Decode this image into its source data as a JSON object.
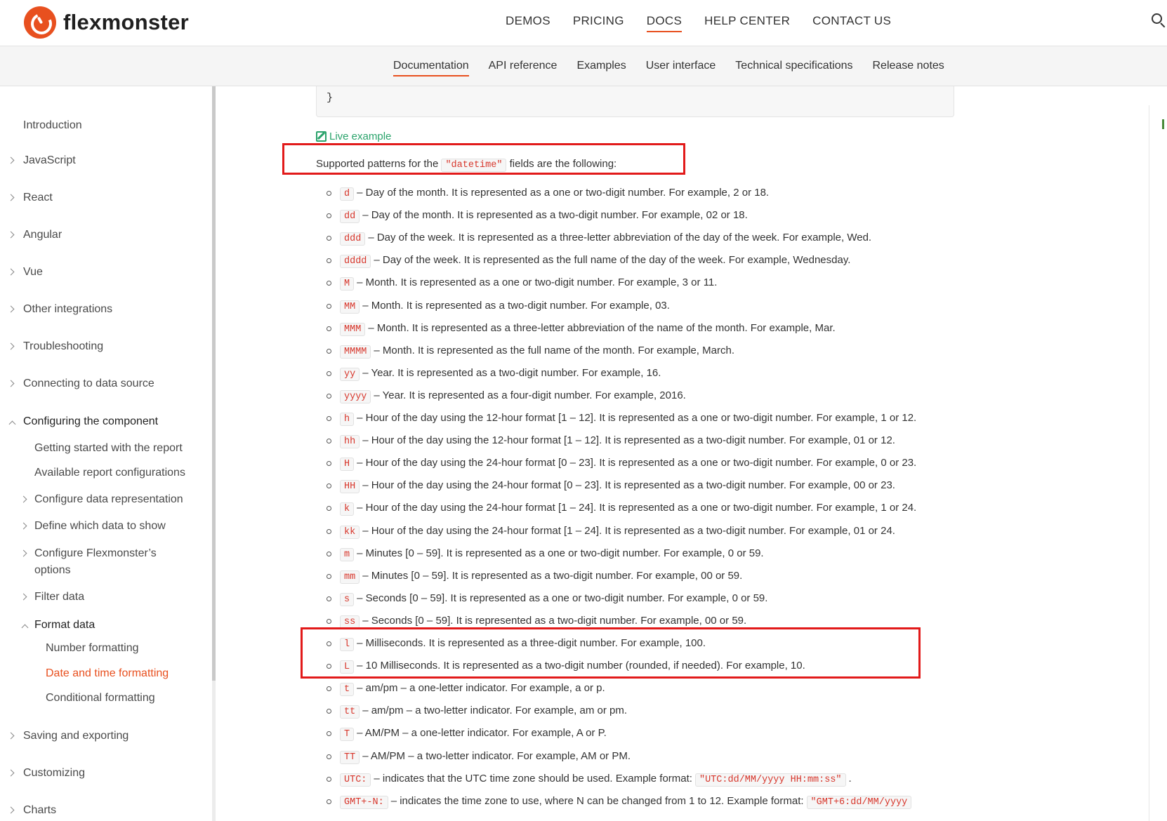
{
  "brand": {
    "name": "flexmonster",
    "accent": "#e8501f"
  },
  "main_nav": [
    "DEMOS",
    "PRICING",
    "DOCS",
    "HELP CENTER",
    "CONTACT US"
  ],
  "sub_nav": [
    "Documentation",
    "API reference",
    "Examples",
    "User interface",
    "Technical specifications",
    "Release notes"
  ],
  "sidebar": {
    "introduction": "Introduction",
    "javascript": "JavaScript",
    "react": "React",
    "angular": "Angular",
    "vue": "Vue",
    "other_integrations": "Other integrations",
    "troubleshooting": "Troubleshooting",
    "connecting": "Connecting to data source",
    "configuring": "Configuring the component",
    "getting_started": "Getting started with the report",
    "available_configs": "Available report configurations",
    "configure_data_rep": "Configure data representation",
    "define_data": "Define which data to show",
    "configure_options_1": "Configure Flexmonster’s",
    "configure_options_2": "options",
    "filter_data": "Filter data",
    "format_data": "Format data",
    "number_formatting": "Number formatting",
    "date_time_formatting": "Date and time formatting",
    "conditional_formatting": "Conditional formatting",
    "saving": "Saving and exporting",
    "customizing": "Customizing",
    "charts": "Charts"
  },
  "content": {
    "code_tail": "}",
    "live_example": "Live example",
    "intro_before": "Supported patterns for the",
    "intro_code": "\"datetime\"",
    "intro_after": "fields are the following:",
    "patterns": [
      {
        "code": "d",
        "text": "– Day of the month. It is represented as a one or two-digit number. For example, 2 or 18."
      },
      {
        "code": "dd",
        "text": "– Day of the month. It is represented as a two-digit number. For example, 02 or 18."
      },
      {
        "code": "ddd",
        "text": "– Day of the week. It is represented as a three-letter abbreviation of the day of the week. For example, Wed."
      },
      {
        "code": "dddd",
        "text": "– Day of the week. It is represented as the full name of the day of the week. For example, Wednesday."
      },
      {
        "code": "M",
        "text": "– Month. It is represented as a one or two-digit number. For example, 3 or 11."
      },
      {
        "code": "MM",
        "text": "– Month. It is represented as a two-digit number. For example, 03."
      },
      {
        "code": "MMM",
        "text": "– Month. It is represented as a three-letter abbreviation of the name of the month. For example, Mar."
      },
      {
        "code": "MMMM",
        "text": "– Month. It is represented as the full name of the month. For example, March."
      },
      {
        "code": "yy",
        "text": "– Year. It is represented as a two-digit number. For example, 16."
      },
      {
        "code": "yyyy",
        "text": "– Year. It is represented as a four-digit number. For example, 2016."
      },
      {
        "code": "h",
        "text": "– Hour of the day using the 12-hour format [1 – 12]. It is represented as a one or two-digit number. For example, 1 or 12."
      },
      {
        "code": "hh",
        "text": "– Hour of the day using the 12-hour format [1 – 12]. It is represented as a two-digit number. For example, 01 or 12."
      },
      {
        "code": "H",
        "text": "– Hour of the day using the 24-hour format [0 – 23]. It is represented as a one or two-digit number. For example, 0 or 23."
      },
      {
        "code": "HH",
        "text": "– Hour of the day using the 24-hour format [0 – 23]. It is represented as a two-digit number. For example, 00 or 23."
      },
      {
        "code": "k",
        "text": "– Hour of the day using the 24-hour format [1 – 24]. It is represented as a one or two-digit number. For example, 1 or 24."
      },
      {
        "code": "kk",
        "text": "– Hour of the day using the 24-hour format [1 – 24]. It is represented as a two-digit number. For example, 01 or 24."
      },
      {
        "code": "m",
        "text": "– Minutes [0 – 59]. It is represented as a one or two-digit number. For example, 0 or 59."
      },
      {
        "code": "mm",
        "text": "– Minutes [0 – 59]. It is represented as a two-digit number. For example, 00 or 59."
      },
      {
        "code": "s",
        "text": "– Seconds [0 – 59]. It is represented as a one or two-digit number. For example, 0 or 59."
      },
      {
        "code": "ss",
        "text": "– Seconds [0 – 59]. It is represented as a two-digit number. For example, 00 or 59."
      },
      {
        "code": "l",
        "text": "– Milliseconds. It is represented as a three-digit number. For example, 100."
      },
      {
        "code": "L",
        "text": "– 10 Milliseconds. It is represented as a two-digit number (rounded, if needed). For example, 10."
      },
      {
        "code": "t",
        "text": "– am/pm – a one-letter indicator. For example, a or p."
      },
      {
        "code": "tt",
        "text": "– am/pm – a two-letter indicator. For example, am or pm."
      },
      {
        "code": "T",
        "text": "– AM/PM – a one-letter indicator. For example, A or P."
      },
      {
        "code": "TT",
        "text": "– AM/PM – a two-letter indicator. For example, AM or PM."
      },
      {
        "code": "UTC:",
        "text": "– indicates that the UTC time zone should be used. Example format:",
        "example": "\"UTC:dd/MM/yyyy HH:mm:ss\"",
        "after": "."
      },
      {
        "code": "GMT+-N:",
        "text": "– indicates the time zone to use, where N can be changed from 1 to 12. Example format:",
        "example": "\"GMT+6:dd/MM/yyyy"
      }
    ]
  },
  "colors": {
    "highlight": "#e21a1a",
    "code_text": "#d7362b",
    "link_green": "#2aa36b"
  }
}
